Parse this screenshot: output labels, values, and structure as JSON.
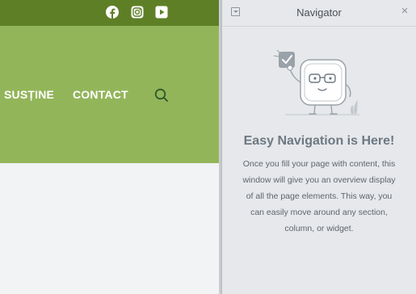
{
  "preview": {
    "social_icons": [
      "facebook-icon",
      "instagram-icon",
      "youtube-icon"
    ],
    "nav_links": [
      "SUSȚINE",
      "CONTACT"
    ],
    "search_icon": "search-icon",
    "colors": {
      "topbar": "#5f7f26",
      "header": "#93b55a",
      "body": "#f1f3f5"
    }
  },
  "navigator": {
    "title": "Navigator",
    "collapse_icon": "collapse-icon",
    "close_icon": "close-icon",
    "illustration": "navigator-mascot-icon",
    "empty_title": "Easy Navigation is Here!",
    "empty_text": "Once you fill your page with content, this window will give you an overview display of all the page elements. This way, you can easily move around any section, column, or widget."
  }
}
